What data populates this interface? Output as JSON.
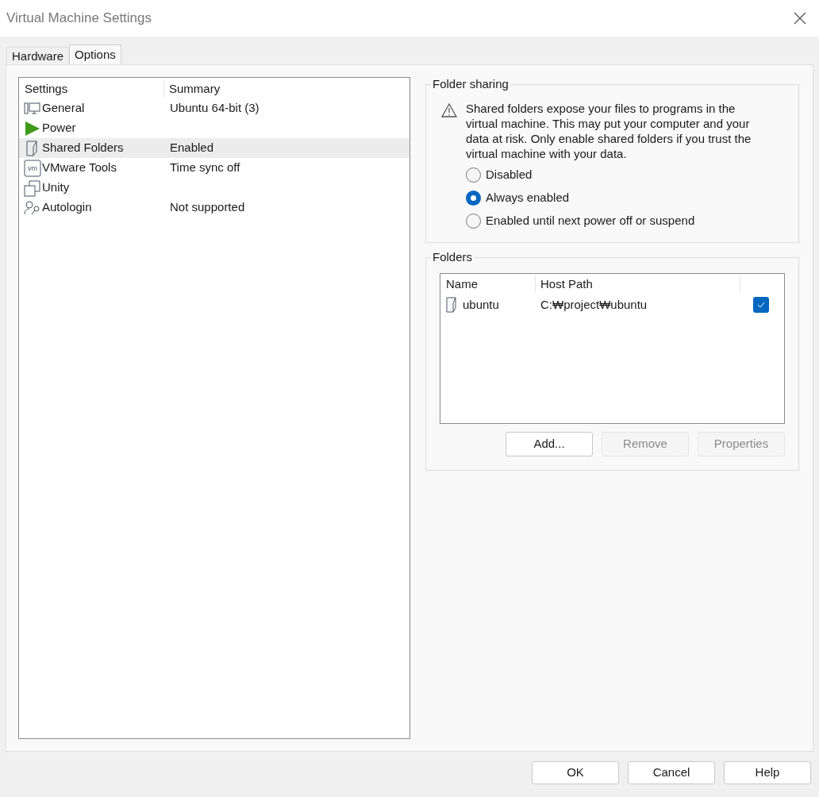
{
  "window": {
    "title": "Virtual Machine Settings"
  },
  "tabs": [
    {
      "label": "Hardware",
      "selected": false
    },
    {
      "label": "Options",
      "selected": true
    }
  ],
  "settings_list": {
    "columns": [
      "Settings",
      "Summary"
    ],
    "items": [
      {
        "kind": "general",
        "name": "General",
        "summary": "Ubuntu 64-bit (3)",
        "selected": false
      },
      {
        "kind": "power",
        "name": "Power",
        "selected": false
      },
      {
        "kind": "shared",
        "name": "Shared Folders",
        "summary": "Enabled",
        "selected": true
      },
      {
        "kind": "tools",
        "icon_text": "vm",
        "name": "VMware Tools",
        "summary": "Time sync off",
        "selected": false
      },
      {
        "kind": "unity",
        "name": "Unity",
        "selected": false
      },
      {
        "kind": "autologin",
        "name": "Autologin",
        "summary": "Not supported",
        "selected": false
      }
    ]
  },
  "folder_sharing": {
    "title": "Folder sharing",
    "warning": "Shared folders expose your files to programs in the virtual machine. This may put your computer and your data at risk. Only enable shared folders if you trust the virtual machine with your data.",
    "options": [
      {
        "label": "Disabled",
        "selected": false
      },
      {
        "label": "Always enabled",
        "selected": true
      },
      {
        "label": "Enabled until next power off or suspend",
        "selected": false
      }
    ]
  },
  "folders": {
    "title": "Folders",
    "columns": [
      "Name",
      "Host Path"
    ],
    "rows": [
      {
        "name": "ubuntu",
        "host_path": "C:₩project₩ubuntu",
        "checked": true
      }
    ],
    "buttons": [
      {
        "label": "Add...",
        "disabled": false
      },
      {
        "label": "Remove",
        "disabled": true
      },
      {
        "label": "Properties",
        "disabled": true
      }
    ]
  },
  "dialog_buttons": [
    "OK",
    "Cancel",
    "Help"
  ]
}
